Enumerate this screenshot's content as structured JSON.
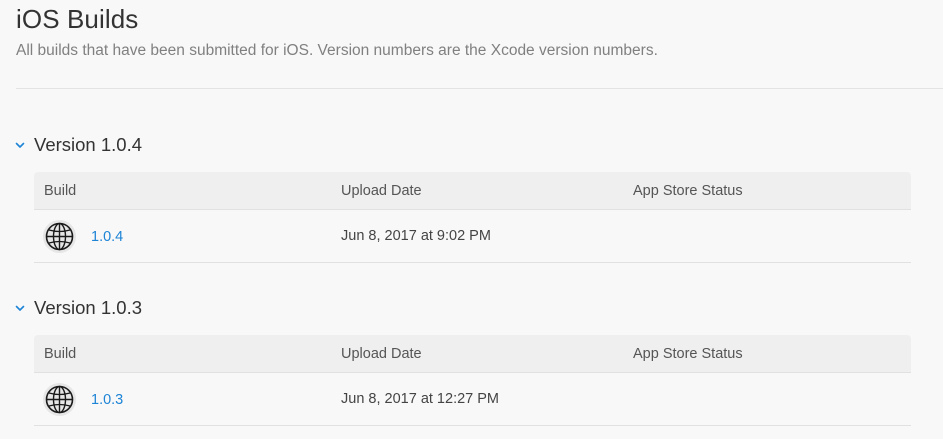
{
  "header": {
    "title": "iOS Builds",
    "subtitle": "All builds that have been submitted for iOS. Version numbers are the Xcode version numbers."
  },
  "colors": {
    "link": "#1d84d6",
    "background": "#f8f8f8",
    "table_header_bg": "#efefef",
    "divider": "#e1e1e1"
  },
  "columns": {
    "build": "Build",
    "upload_date": "Upload Date",
    "status": "App Store Status"
  },
  "versions": [
    {
      "label": "Version 1.0.4",
      "expanded": true,
      "builds": [
        {
          "icon": "globe-icon",
          "build": "1.0.4",
          "upload_date": "Jun 8, 2017 at 9:02 PM",
          "status": ""
        }
      ]
    },
    {
      "label": "Version 1.0.3",
      "expanded": true,
      "builds": [
        {
          "icon": "globe-icon",
          "build": "1.0.3",
          "upload_date": "Jun 8, 2017 at 12:27 PM",
          "status": ""
        }
      ]
    }
  ]
}
